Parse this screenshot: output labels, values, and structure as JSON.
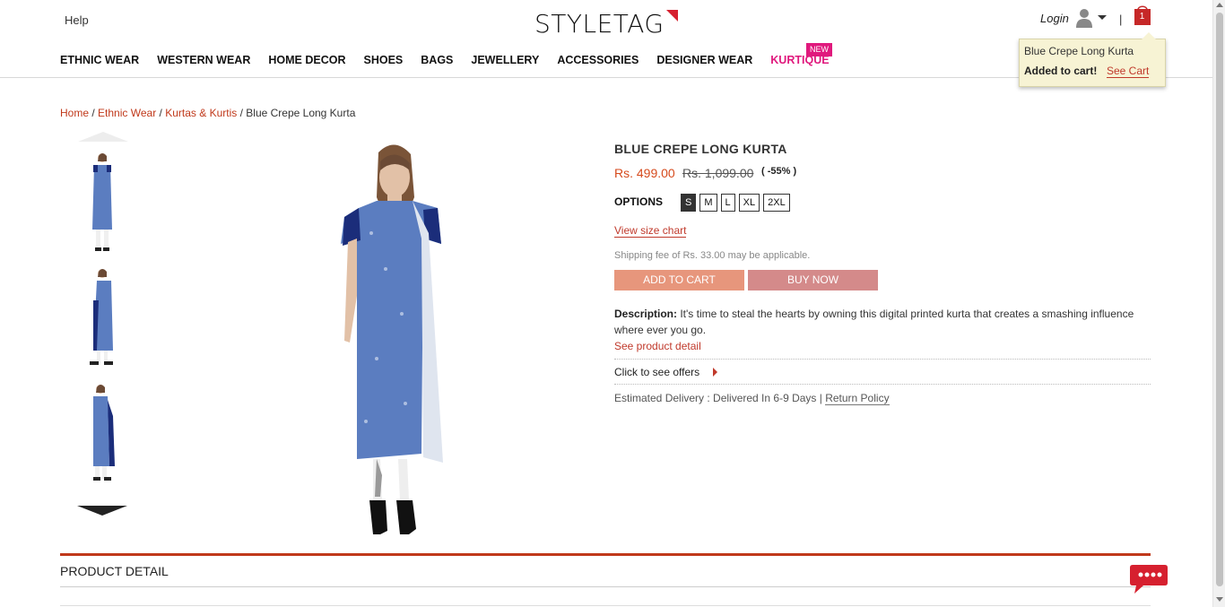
{
  "header": {
    "help": "Help",
    "logo": "STYLETAG",
    "login": "Login",
    "separator": "|",
    "cart_count": "1"
  },
  "nav": {
    "items": [
      "ETHNIC WEAR",
      "WESTERN WEAR",
      "HOME DECOR",
      "SHOES",
      "BAGS",
      "JEWELLERY",
      "ACCESSORIES",
      "DESIGNER WEAR"
    ],
    "kurtique": "KURTIQUE",
    "new_badge": "NEW"
  },
  "tooltip": {
    "title": "Blue Crepe Long Kurta",
    "added": "Added to cart!",
    "see_cart": "See Cart"
  },
  "breadcrumb": {
    "home": "Home",
    "cat1": "Ethnic Wear",
    "cat2": "Kurtas & Kurtis",
    "current": "Blue Crepe Long Kurta",
    "sep": "/"
  },
  "product": {
    "title": "BLUE CREPE LONG KURTA",
    "price": "Rs. 499.00",
    "mrp": "Rs. 1,099.00",
    "discount": "( -55% )",
    "options_label": "OPTIONS",
    "sizes": [
      "S",
      "M",
      "L",
      "XL",
      "2XL"
    ],
    "selected_size": "S",
    "size_chart": "View size chart",
    "shipping": "Shipping fee of Rs. 33.00 may be applicable.",
    "add_to_cart": "ADD TO CART",
    "buy_now": "BUY NOW",
    "desc_label": "Description:",
    "desc_text": " It's time to steal the hearts by owning this digital printed kurta that creates a smashing influence where ever you go.",
    "see_detail": "See product detail",
    "offers": "Click to see offers",
    "delivery": "Estimated Delivery : Delivered In 6-9 Days | ",
    "return_policy": "Return Policy"
  },
  "section": {
    "product_detail": "PRODUCT DETAIL"
  },
  "colors": {
    "accent": "#c0391b",
    "price": "#d64a1c",
    "kurtique": "#e0197d",
    "add_btn": "#e7967c",
    "buy_btn": "#d48a8a",
    "kurta_blue": "#5b7dc0",
    "chat": "#d6202f"
  }
}
